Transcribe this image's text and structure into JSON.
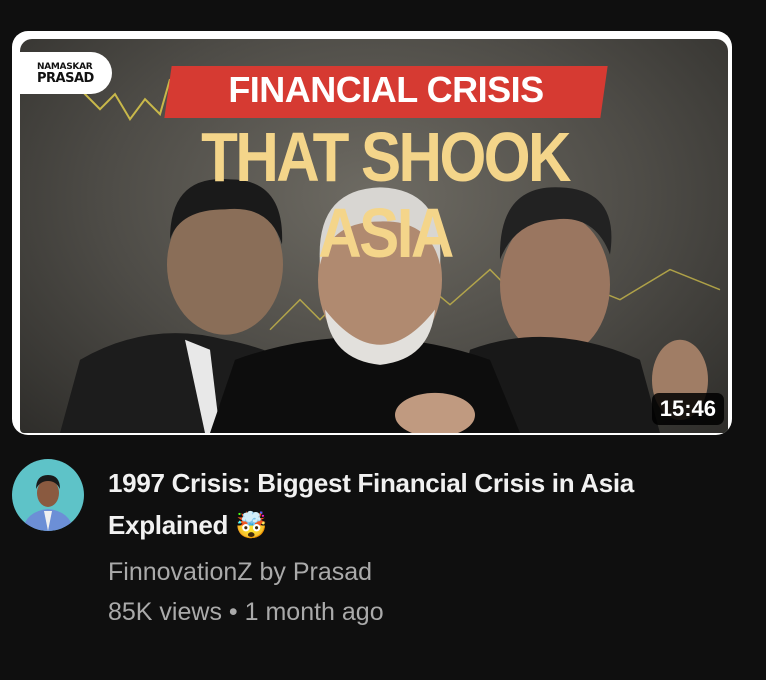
{
  "video": {
    "thumbnail": {
      "logo_line1": "NAMASKAR",
      "logo_line2": "PRASAD",
      "banner_text": "FINANCIAL CRISIS",
      "headline": "THAT SHOOK ASIA",
      "duration": "15:46"
    },
    "title": "1997 Crisis: Biggest Financial Crisis in Asia Explained 🤯",
    "channel": "FinnovationZ by Prasad",
    "views": "85K views",
    "separator": "•",
    "age": "1 month ago"
  },
  "colors": {
    "background": "#0f0f0f",
    "banner": "#d63a32",
    "headline": "#f4d58a",
    "meta_text": "#aaaaaa"
  }
}
